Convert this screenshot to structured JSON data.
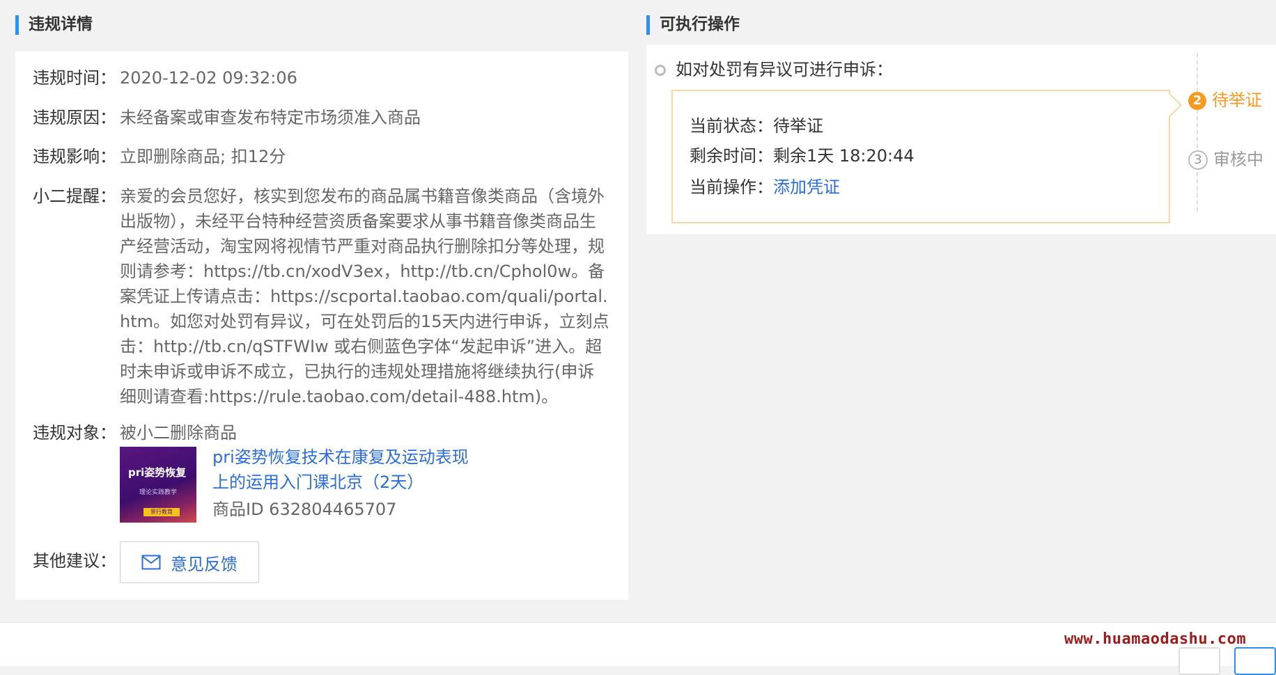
{
  "left": {
    "title": "违规详情",
    "rows": {
      "time": {
        "label": "违规时间：",
        "value": "2020-12-02 09:32:06"
      },
      "reason": {
        "label": "违规原因：",
        "value": "未经备案或审查发布特定市场须准入商品"
      },
      "impact": {
        "label": "违规影响：",
        "value": "立即删除商品; 扣12分"
      },
      "tip": {
        "label": "小二提醒：",
        "value": "亲爱的会员您好，核实到您发布的商品属书籍音像类商品（含境外出版物），未经平台特种经营资质备案要求从事书籍音像类商品生产经营活动，淘宝网将视情节严重对商品执行删除扣分等处理，规则请参考：https://tb.cn/xodV3ex，http://tb.cn/Cphol0w。备案凭证上传请点击：https://scportal.taobao.com/quali/portal.htm。如您对处罚有异议，可在处罚后的15天内进行申诉，立刻点击：http://tb.cn/qSTFWIw 或右侧蓝色字体“发起申诉”进入。超时未申诉或申诉不成立，已执行的违规处理措施将继续执行(申诉细则请查看:https://rule.taobao.com/detail-488.htm)。"
      },
      "object": {
        "label": "违规对象：",
        "value": "被小二删除商品"
      },
      "suggest": {
        "label": "其他建议："
      }
    },
    "product": {
      "thumb_title": "pri姿势恢复",
      "thumb_sub": "理论实践教学",
      "thumb_badge": "景行教育",
      "name": "pri姿势恢复技术在康复及运动表现上的运用入门课北京（2天）",
      "id_text": "商品ID 632804465707"
    },
    "feedback_button": "意见反馈"
  },
  "right": {
    "title": "可执行操作",
    "appeal_text": "如对处罚有异议可进行申诉：",
    "status": {
      "state_label": "当前状态：",
      "state_value": "待举证",
      "remain_label": "剩余时间：",
      "remain_value": "剩余1天 18:20:44",
      "op_label": "当前操作：",
      "op_value": "添加凭证"
    },
    "steps": [
      {
        "num": "2",
        "label": "待举证"
      },
      {
        "num": "3",
        "label": "审核中"
      }
    ]
  },
  "watermark": "www.huamaodashu.com",
  "colors": {
    "accent": "#2a8ff7",
    "link": "#2a6ddb",
    "warning": "#f59a23"
  }
}
